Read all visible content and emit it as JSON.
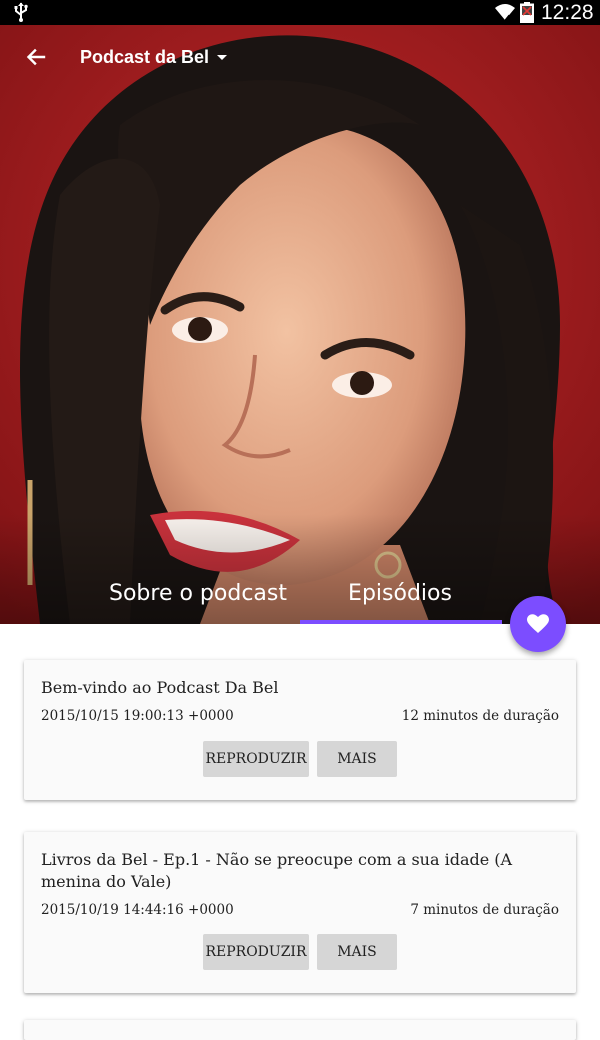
{
  "status_bar": {
    "time": "12:28",
    "icons": [
      "usb-icon",
      "wifi-icon",
      "battery-icon"
    ]
  },
  "app_bar": {
    "title": "Podcast da Bel",
    "back_icon": "arrow-left-icon",
    "dropdown_icon": "caret-down-icon"
  },
  "tabs": [
    {
      "label": "Sobre o podcast",
      "selected": false
    },
    {
      "label": "Episódios",
      "selected": true
    }
  ],
  "fab": {
    "icon": "heart-icon"
  },
  "colors": {
    "accent": "#7c4dff",
    "card_background": "#fafafa",
    "button_background": "#d6d6d6",
    "hero_background": "#a51a1d"
  },
  "episodes": [
    {
      "title": "Bem-vindo ao Podcast Da Bel",
      "date": "2015/10/15 19:00:13 +0000",
      "duration": "12 minutos de duração",
      "play_label": "REPRODUZIR",
      "more_label": "MAIS"
    },
    {
      "title": "Livros da Bel - Ep.1 - Não se preocupe com a sua idade (A menina do Vale)",
      "date": "2015/10/19 14:44:16 +0000",
      "duration": "7 minutos de duração",
      "play_label": "REPRODUZIR",
      "more_label": "MAIS"
    }
  ]
}
